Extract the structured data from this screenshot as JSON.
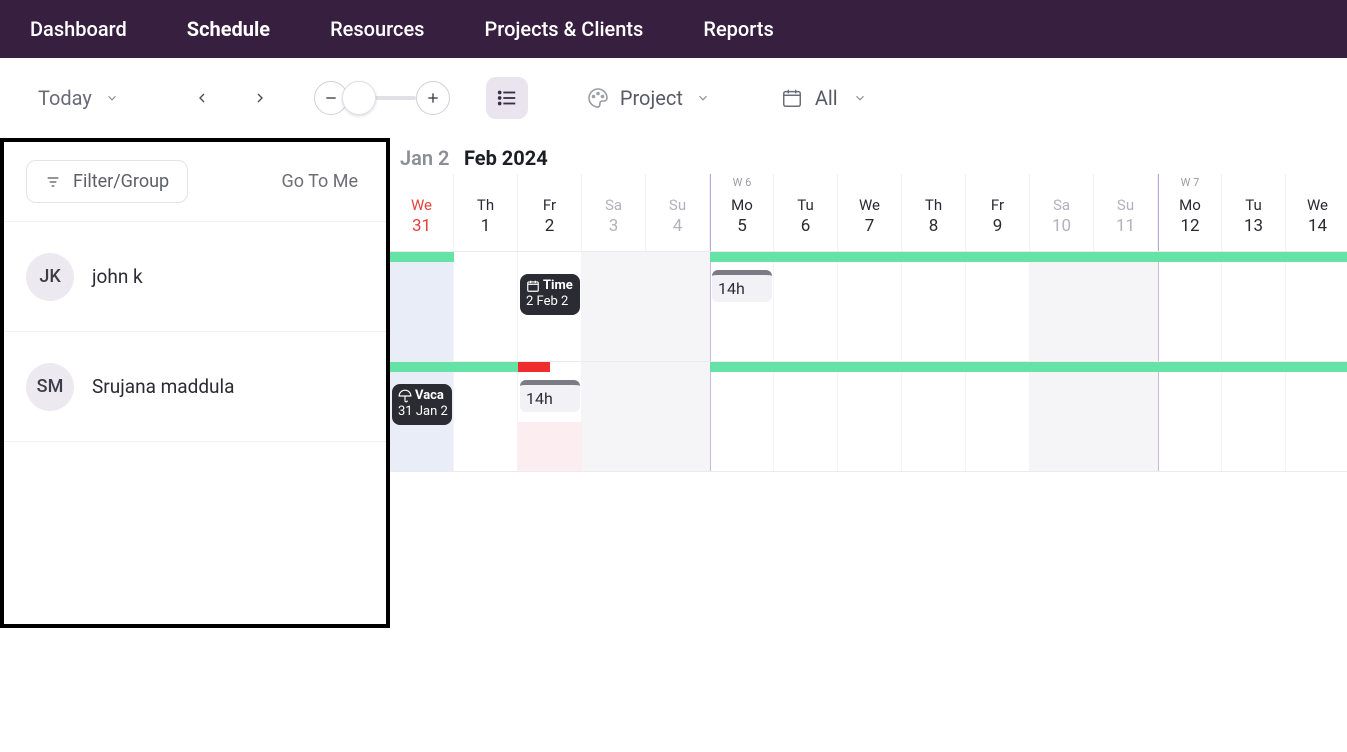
{
  "nav": {
    "items": [
      "Dashboard",
      "Schedule",
      "Resources",
      "Projects & Clients",
      "Reports"
    ],
    "active_index": 1
  },
  "toolbar": {
    "today_label": "Today",
    "group_label": "Project",
    "range_label": "All"
  },
  "sidebar": {
    "filter_label": "Filter/Group",
    "gotome_label": "Go To Me",
    "people": [
      {
        "initials": "JK",
        "name": "john k"
      },
      {
        "initials": "SM",
        "name": "Srujana maddula"
      }
    ]
  },
  "timeline": {
    "months": {
      "prev": "Jan 2",
      "current": "Feb 2024"
    },
    "weeks": [
      "W 6",
      "W 7"
    ],
    "days": [
      {
        "dow": "We",
        "dom": "31",
        "kind": "red"
      },
      {
        "dow": "Th",
        "dom": "1",
        "kind": "norm"
      },
      {
        "dow": "Fr",
        "dom": "2",
        "kind": "norm"
      },
      {
        "dow": "Sa",
        "dom": "3",
        "kind": "weekend"
      },
      {
        "dow": "Su",
        "dom": "4",
        "kind": "weekend"
      },
      {
        "dow": "Mo",
        "dom": "5",
        "kind": "mon",
        "wk": "W 6"
      },
      {
        "dow": "Tu",
        "dom": "6",
        "kind": "norm"
      },
      {
        "dow": "We",
        "dom": "7",
        "kind": "norm"
      },
      {
        "dow": "Th",
        "dom": "8",
        "kind": "norm"
      },
      {
        "dow": "Fr",
        "dom": "9",
        "kind": "norm"
      },
      {
        "dow": "Sa",
        "dom": "10",
        "kind": "weekend"
      },
      {
        "dow": "Su",
        "dom": "11",
        "kind": "weekend"
      },
      {
        "dow": "Mo",
        "dom": "12",
        "kind": "mon",
        "wk": "W 7"
      },
      {
        "dow": "Tu",
        "dom": "13",
        "kind": "norm"
      },
      {
        "dow": "We",
        "dom": "14",
        "kind": "norm"
      }
    ],
    "rows": [
      {
        "avail": [
          {
            "start": 0,
            "span": 1
          },
          {
            "start": 5,
            "span": 7
          },
          {
            "start": 12,
            "span": 3
          }
        ],
        "chips": [
          {
            "col": 2,
            "label": "Time",
            "sub": "2 Feb 2",
            "icon": "calendar"
          }
        ],
        "hours": [
          {
            "col": 5,
            "text": "14h"
          }
        ]
      },
      {
        "avail": [
          {
            "start": 0,
            "span": 2
          },
          {
            "start": 5,
            "span": 7
          },
          {
            "start": 12,
            "span": 3
          }
        ],
        "red": [
          {
            "start": 2,
            "span": 0.5
          }
        ],
        "pink": [
          {
            "col": 2
          }
        ],
        "chips": [
          {
            "col": 0,
            "label": "Vaca",
            "sub": "31 Jan 2",
            "icon": "umbrella"
          }
        ],
        "hours": [
          {
            "col": 2,
            "text": "14h"
          }
        ]
      }
    ]
  }
}
